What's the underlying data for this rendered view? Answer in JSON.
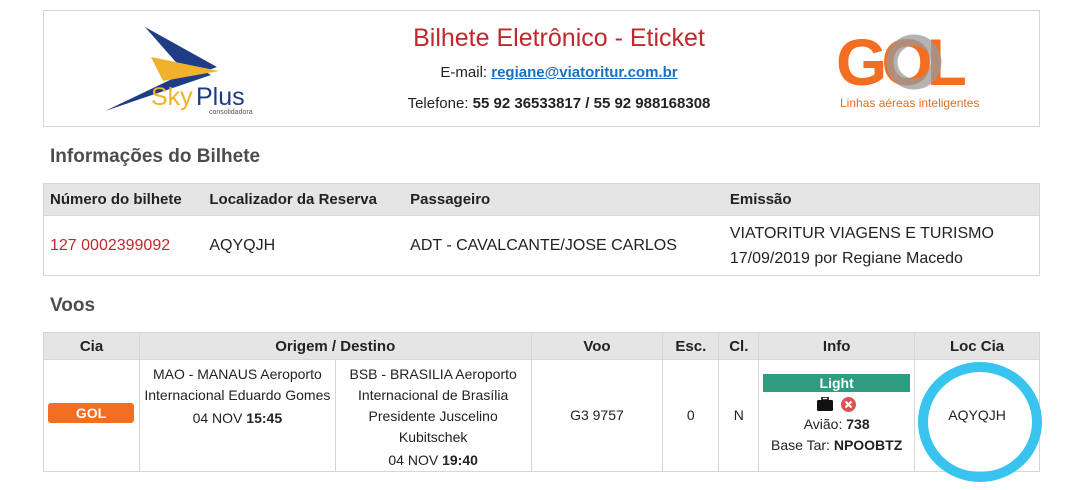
{
  "header": {
    "title": "Bilhete Eletrônico - Eticket",
    "email_label": "E-mail:",
    "email": "regiane@viatoritur.com.br",
    "phone_label": "Telefone:",
    "phone": "55 92 36533817 / 55 92 988168308",
    "skyplus_logo": {
      "brand_sky": "Sky",
      "brand_plus": "Plus",
      "tagline": "consolidadora"
    },
    "gol_logo": {
      "brand": "GOL",
      "tagline": "Linhas aéreas inteligentes"
    }
  },
  "ticket_info": {
    "section_title": "Informações do Bilhete",
    "columns": [
      "Número do bilhete",
      "Localizador da Reserva",
      "Passageiro",
      "Emissão"
    ],
    "row": {
      "ticket_number": "127 0002399092",
      "locator": "AQYQJH",
      "passenger": "ADT - CAVALCANTE/JOSE CARLOS",
      "issuer": "VIATORITUR VIAGENS E TURISMO",
      "issued": "17/09/2019 por Regiane Macedo"
    }
  },
  "flights": {
    "section_title": "Voos",
    "columns": [
      "Cia",
      "Origem / Destino",
      "Voo",
      "Esc.",
      "Cl.",
      "Info",
      "Loc Cia"
    ],
    "rows": [
      {
        "airline_logo": "GOL",
        "origin": "MAO - MANAUS Aeroporto Internacional Eduardo Gomes",
        "origin_date": "04 NOV",
        "origin_time": "15:45",
        "destination": "BSB - BRASILIA Aeroporto Internacional de Brasília Presidente Juscelino Kubitschek",
        "destination_date": "04 NOV",
        "destination_time": "19:40",
        "flight": "G3 9757",
        "stops": "0",
        "class": "N",
        "fare_family": "Light",
        "icons": [
          "baggage-icon",
          "no-refund-icon"
        ],
        "aircraft_label": "Avião:",
        "aircraft": "738",
        "fare_basis_label": "Base Tar:",
        "fare_basis": "NPOOBTZ",
        "airline_locator": "AQYQJH"
      }
    ]
  },
  "colors": {
    "title_red": "#c0282d",
    "link_blue": "#1a6fc4",
    "fare_badge_green": "#2e9d7f",
    "gol_orange": "#f36e21",
    "highlight_ring": "#39c4f0"
  }
}
